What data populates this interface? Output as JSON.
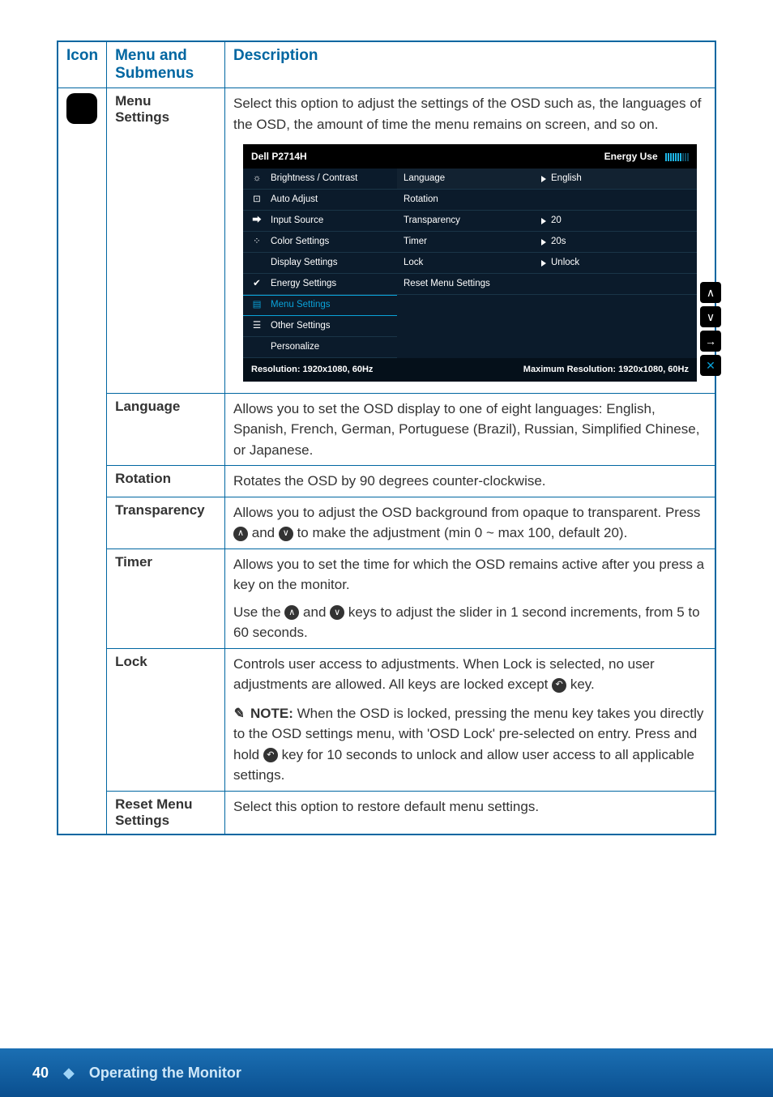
{
  "headers": {
    "icon": "Icon",
    "menu": "Menu and",
    "submenus": "Submenus",
    "description": "Description"
  },
  "rows": {
    "menu_settings": {
      "title_line1": "Menu",
      "title_line2": "Settings",
      "intro": "Select this option to adjust the settings of the OSD such as, the languages of the OSD, the amount of time the menu remains on screen, and so on."
    },
    "language": {
      "title": "Language",
      "desc": "Allows you to set the OSD display to one of eight languages: English, Spanish, French, German, Portuguese (Brazil), Russian, Simplified Chinese, or Japanese."
    },
    "rotation": {
      "title": "Rotation",
      "desc": "Rotates the OSD by 90 degrees counter-clockwise."
    },
    "transparency": {
      "title": "Transparency",
      "p1a": "Allows you to adjust the OSD background from opaque to transparent. Press ",
      "p1b": " and ",
      "p1c": " to make the adjustment (min 0 ~ max 100, default 20)."
    },
    "timer": {
      "title": "Timer",
      "p1": "Allows you to set the time for which the OSD remains active after you press a key on the monitor.",
      "p2a": "Use the ",
      "p2b": " and ",
      "p2c": " keys to adjust the slider in 1 second increments, from 5 to 60 seconds."
    },
    "lock": {
      "title": "Lock",
      "p1a": "Controls user access to adjustments. When Lock is selected, no user adjustments are allowed. All keys are locked except ",
      "p1b": " key.",
      "note_label": "NOTE:",
      "note_a": " When the OSD is locked, pressing the menu key takes you directly to the OSD settings menu, with 'OSD Lock' pre-selected on entry. Press and hold ",
      "note_b": " key for 10 seconds to unlock and allow user access to all applicable settings."
    },
    "reset": {
      "title_line1": "Reset Menu",
      "title_line2": "Settings",
      "desc": "Select this option to restore default menu settings."
    }
  },
  "osd": {
    "model": "Dell P2714H",
    "energy_label": "Energy Use",
    "left": [
      {
        "icon": "✳",
        "label": "Brightness / Contrast"
      },
      {
        "icon": "⊡",
        "label": "Auto Adjust"
      },
      {
        "icon": "⟶",
        "label": "Input Source"
      },
      {
        "icon": "⸬",
        "label": "Color Settings"
      },
      {
        "icon": "",
        "label": "Display Settings"
      },
      {
        "icon": "⚘",
        "label": "Energy Settings"
      },
      {
        "icon": "≡",
        "label": "Menu Settings",
        "sel": true
      },
      {
        "icon": "☰",
        "label": "Other Settings"
      },
      {
        "icon": "",
        "label": "Personalize"
      }
    ],
    "mid": [
      "Language",
      "Rotation",
      "Transparency",
      "Timer",
      "Lock",
      "Reset Menu Settings"
    ],
    "right": {
      "Language": "English",
      "Transparency": "20",
      "Timer": "20s",
      "Lock": "Unlock"
    },
    "footer_left": "Resolution: 1920x1080, 60Hz",
    "footer_right": "Maximum Resolution: 1920x1080, 60Hz"
  },
  "footer": {
    "page": "40",
    "section": "Operating the Monitor"
  }
}
